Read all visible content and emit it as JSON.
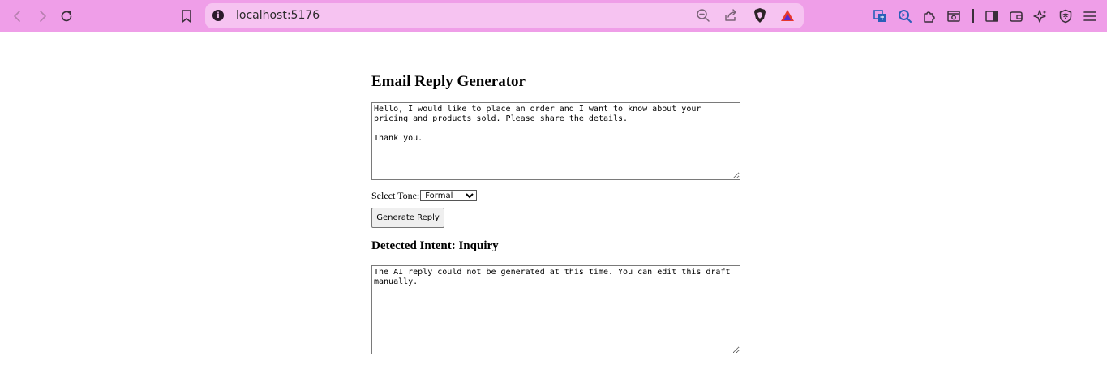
{
  "browser": {
    "url": "localhost:5176",
    "info_glyph": "i",
    "colors": {
      "toolbar": "#ef9ee8",
      "urlbar": "#f6c3f1"
    }
  },
  "icons": {
    "nav": [
      "back-icon",
      "forward-icon",
      "reload-icon",
      "bookmark-icon"
    ],
    "url": [
      "zoom-out-icon",
      "share-icon",
      "brave-shields-icon",
      "brave-rewards-icon"
    ],
    "extensions": [
      "translate-icon",
      "lens-search-icon",
      "extensions-icon",
      "screenshot-icon",
      "sidebar-icon",
      "wallet-icon",
      "leo-ai-icon",
      "vpn-icon",
      "menu-icon"
    ]
  },
  "app": {
    "title": "Email Reply Generator",
    "email_text": "Hello, I would like to place an order and I want to know about your pricing and products sold. Please share the details.\n\nThank you.",
    "tone_label": "Select Tone:",
    "tone_selected": "Formal",
    "generate_label": "Generate Reply",
    "intent_text": "Detected Intent: Inquiry",
    "reply_text": "The AI reply could not be generated at this time. You can edit this draft manually."
  }
}
